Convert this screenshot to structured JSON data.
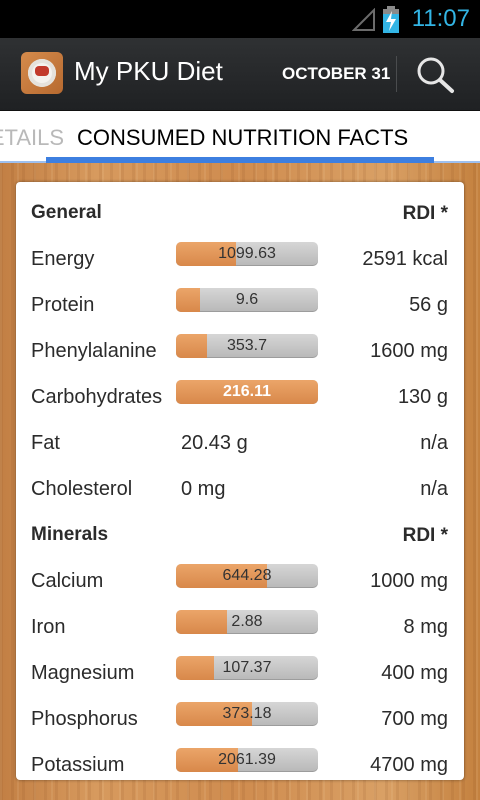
{
  "status_bar": {
    "time": "11:07",
    "icons": [
      "signal-icon",
      "battery-charging-icon"
    ]
  },
  "action_bar": {
    "app_title": "My PKU Diet",
    "date_label": "OCTOBER 31",
    "icons": [
      "app-logo-icon",
      "search-icon"
    ]
  },
  "tabs": {
    "previous_partial_label": "DETAILS",
    "active_label": "CONSUMED NUTRITION FACTS"
  },
  "sections": [
    {
      "title": "General",
      "rdi_label": "RDI *",
      "rows": [
        {
          "name": "Energy",
          "consumed": "1099.63",
          "fraction": 0.424,
          "rdi": "2591 kcal",
          "type": "bar"
        },
        {
          "name": "Protein",
          "consumed": "9.6",
          "fraction": 0.17,
          "rdi": "56 g",
          "type": "bar"
        },
        {
          "name": "Phenylalanine",
          "consumed": "353.7",
          "fraction": 0.221,
          "rdi": "1600 mg",
          "type": "bar"
        },
        {
          "name": "Carbohydrates",
          "consumed": "216.11",
          "fraction": 1.0,
          "rdi": "130 g",
          "type": "bar"
        },
        {
          "name": "Fat",
          "consumed": "20.43 g",
          "rdi": "n/a",
          "type": "text"
        },
        {
          "name": "Cholesterol",
          "consumed": "0 mg",
          "rdi": "n/a",
          "type": "text"
        }
      ]
    },
    {
      "title": "Minerals",
      "rdi_label": "RDI *",
      "rows": [
        {
          "name": "Calcium",
          "consumed": "644.28",
          "fraction": 0.644,
          "rdi": "1000 mg",
          "type": "bar"
        },
        {
          "name": "Iron",
          "consumed": "2.88",
          "fraction": 0.36,
          "rdi": "8 mg",
          "type": "bar"
        },
        {
          "name": "Magnesium",
          "consumed": "107.37",
          "fraction": 0.268,
          "rdi": "400 mg",
          "type": "bar"
        },
        {
          "name": "Phosphorus",
          "consumed": "373.18",
          "fraction": 0.533,
          "rdi": "700 mg",
          "type": "bar"
        },
        {
          "name": "Potassium",
          "consumed": "2061.39",
          "fraction": 0.439,
          "rdi": "4700 mg",
          "type": "bar"
        }
      ]
    }
  ],
  "colors": {
    "accent_blue": "#33b5e5",
    "tab_indicator": "#3d7fe0",
    "bar_fill": "#e09a5c",
    "bar_track": "#c6c6c6"
  }
}
